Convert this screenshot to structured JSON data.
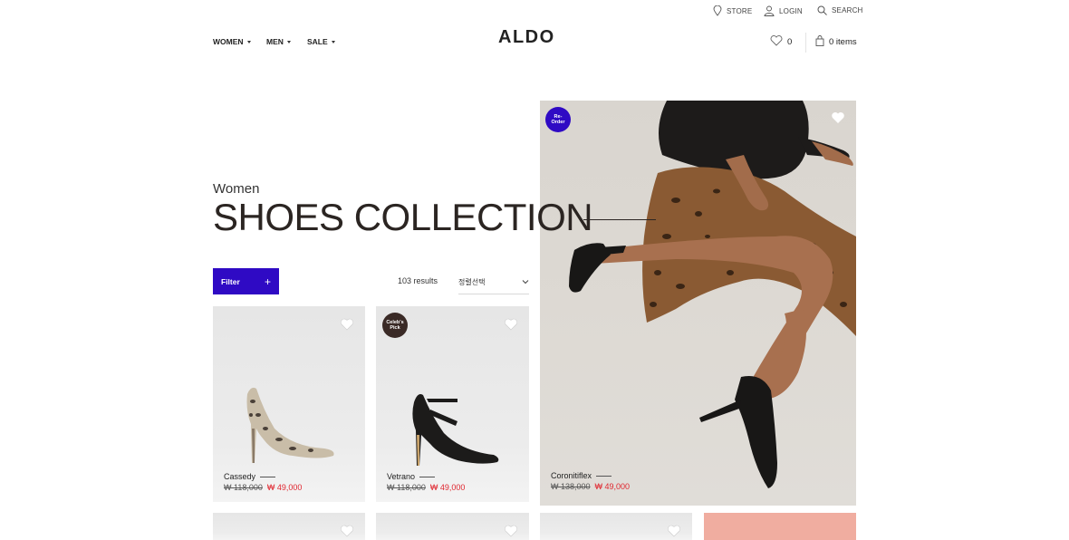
{
  "header": {
    "utility": {
      "store": "STORE",
      "login": "LOGIN",
      "search": "SEARCH"
    },
    "nav": {
      "women": "WOMEN",
      "men": "MEN",
      "sale": "SALE"
    },
    "logo": "ALDO",
    "wishlist_count": "0",
    "bag_label": "0 items"
  },
  "page": {
    "subtitle": "Women",
    "title": "SHOES COLLECTION"
  },
  "toolbar": {
    "filter_label": "Filter",
    "results": "103 results",
    "sort_value": "정렬선택"
  },
  "hero": {
    "badge": "Re-\nOrder",
    "badge_color": "#2f0ac4",
    "name": "Coronitiflex",
    "old_price": "₩ 138,000",
    "sale_price": "₩ 49,000"
  },
  "products": [
    {
      "name": "Cassedy",
      "old_price": "₩ 118,000",
      "sale_price": "₩ 49,000"
    },
    {
      "name": "Vetrano",
      "old_price": "₩ 118,000",
      "sale_price": "₩ 49,000",
      "badge": "Celeb's\nPick"
    }
  ],
  "colors": {
    "accent": "#2f0ac4",
    "sale": "#e0262f",
    "promo_tile": "#f0ada0"
  }
}
